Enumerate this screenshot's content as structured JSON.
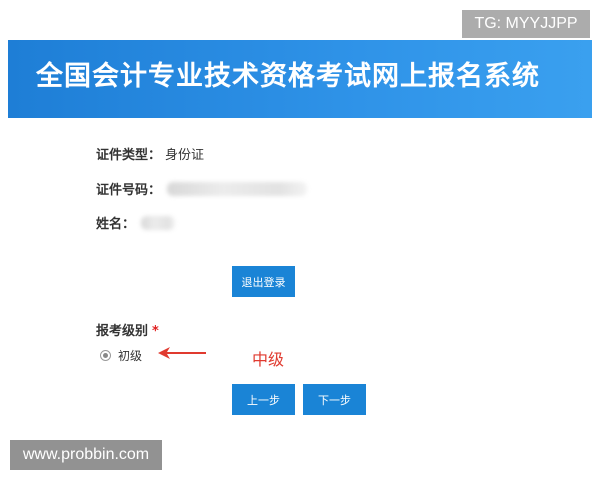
{
  "banner": {
    "title": "全国会计专业技术资格考试网上报名系统"
  },
  "watermarks": {
    "tg": "TG: MYYJJPP",
    "site": "www.probbin.com"
  },
  "info": {
    "id_type_label": "证件类型：",
    "id_type_value": "身份证",
    "id_number_label": "证件号码：",
    "name_label": "姓名："
  },
  "buttons": {
    "logout": "退出登录",
    "prev": "上一步",
    "next": "下一步"
  },
  "level": {
    "label": "报考级别",
    "required_mark": "*",
    "option": "初级",
    "option_selected": true
  },
  "annotation": {
    "text": "中级",
    "color": "#e03a2f"
  },
  "colors": {
    "banner": "#2589e0",
    "button": "#1a84d6",
    "required": "#e02020"
  }
}
